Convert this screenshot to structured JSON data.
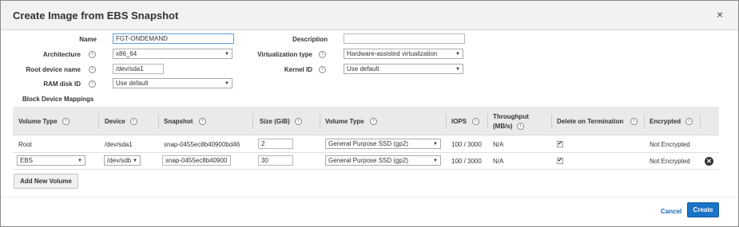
{
  "dialog": {
    "title": "Create Image from EBS Snapshot",
    "close_symbol": "×"
  },
  "form": {
    "name_label": "Name",
    "name_value": "FGT-ONDEMAND",
    "description_label": "Description",
    "description_value": "",
    "architecture_label": "Architecture",
    "architecture_value": "x86_64",
    "virtualization_label": "Virtualization type",
    "virtualization_value": "Hardware-assisted virtualization",
    "root_device_label": "Root device name",
    "root_device_value": "/dev/sda1",
    "kernel_label": "Kernel ID",
    "kernel_value": "Use default",
    "ramdisk_label": "RAM disk ID",
    "ramdisk_value": "Use default"
  },
  "mappings": {
    "section_title": "Block Device Mappings",
    "headers": {
      "volume_type": "Volume Type",
      "device": "Device",
      "snapshot": "Snapshot",
      "size": "Size (GiB)",
      "ebs_volume_type": "Volume Type",
      "iops": "IOPS",
      "throughput_line1": "Throughput",
      "throughput_line2": "(MB/s)",
      "delete_on_termination": "Delete on Termination",
      "encrypted": "Encrypted"
    },
    "rows": [
      {
        "volume_type": "Root",
        "device": "/dev/sda1",
        "snapshot": "snap-0455ec8b40900bd46",
        "size": "2",
        "ebs_volume_type": "General Purpose SSD (gp2)",
        "iops": "100 / 3000",
        "throughput": "N/A",
        "delete_on_termination": true,
        "encrypted": "Not Encrypted"
      },
      {
        "volume_type": "EBS",
        "device": "/dev/sdb",
        "snapshot": "snap-0455ec8b40900",
        "size": "30",
        "ebs_volume_type": "General Purpose SSD (gp2)",
        "iops": "100 / 3000",
        "throughput": "N/A",
        "delete_on_termination": true,
        "encrypted": "Not Encrypted"
      }
    ],
    "add_button": "Add New Volume",
    "remove_symbol": "✕"
  },
  "footer": {
    "cancel": "Cancel",
    "create": "Create"
  },
  "icons": {
    "info": "i",
    "checkmark": "✔",
    "dropdown": "▼"
  },
  "colors": {
    "primary_button": "#1a73c7",
    "link": "#1166bb",
    "header_bg": "#f2f2f2",
    "table_header_bg": "#eaeaea"
  }
}
